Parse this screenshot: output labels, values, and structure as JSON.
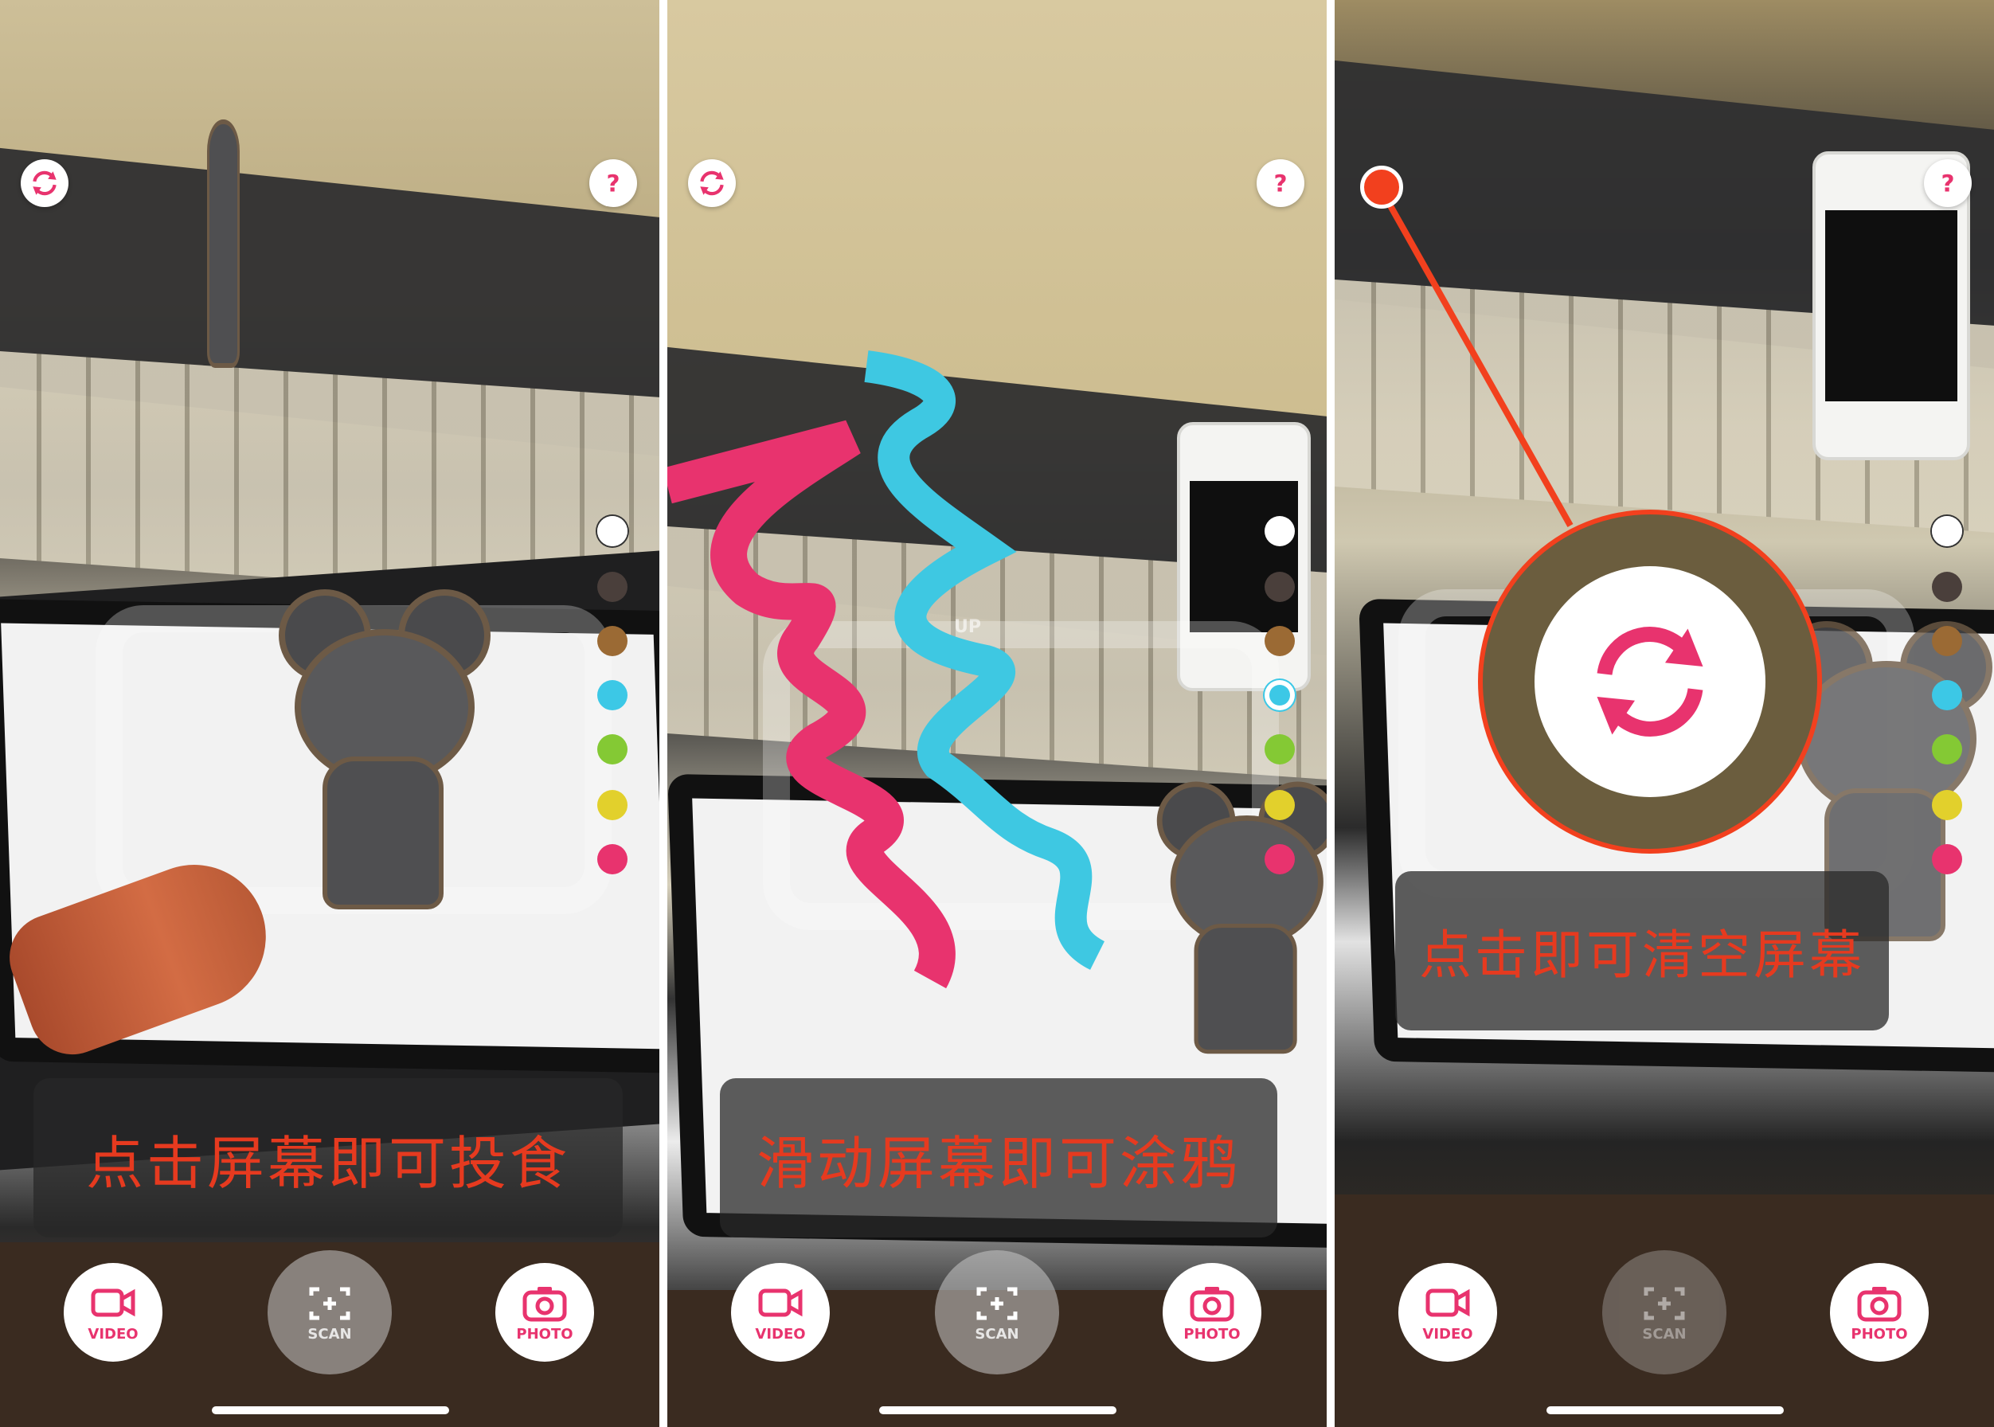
{
  "panels": [
    {
      "hint": "点击屏幕即可投食",
      "buttons": {
        "video": "VIDEO",
        "scan": "SCAN",
        "photo": "PHOTO"
      }
    },
    {
      "hint": "滑动屏幕即可涂鸦",
      "buttons": {
        "video": "VIDEO",
        "scan": "SCAN",
        "photo": "PHOTO"
      }
    },
    {
      "hint": "点击即可清空屏幕",
      "buttons": {
        "video": "VIDEO",
        "scan": "SCAN",
        "photo": "PHOTO"
      }
    }
  ],
  "scan_overlay_text": "UP",
  "icons": {
    "reset": "refresh-icon",
    "help": "question-icon",
    "video": "video-camera-icon",
    "scan": "scan-focus-icon",
    "photo": "camera-icon"
  },
  "palette": [
    "#ffffff",
    "#4a3f3b",
    "#9b6a34",
    "#3cc8e6",
    "#84c934",
    "#e2d02c",
    "#e8336e"
  ],
  "colors": {
    "accent": "#e8336e",
    "hint_text": "#e63a1f",
    "doodle_pink": "#e8336e",
    "doodle_cyan": "#3ec8e2",
    "highlight": "#f2401e"
  }
}
